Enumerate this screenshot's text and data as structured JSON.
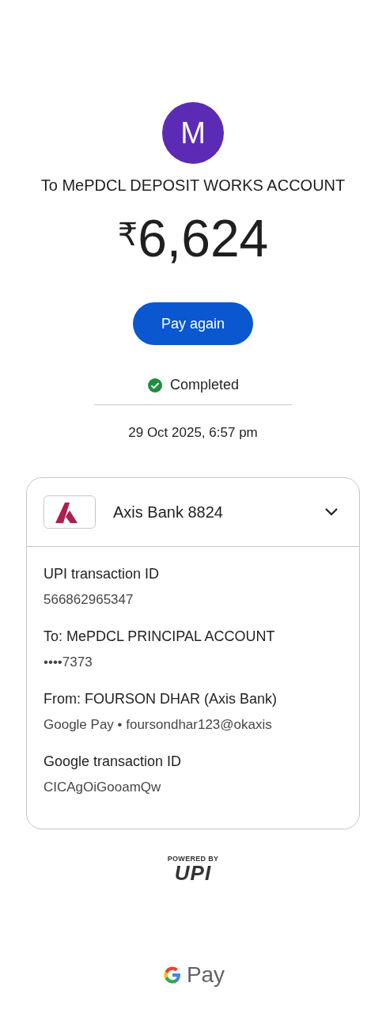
{
  "avatar": {
    "letter": "M"
  },
  "recipient": "To MePDCL DEPOSIT WORKS ACCOUNT",
  "amount": {
    "currency": "₹",
    "value": "6,624"
  },
  "pay_again_button": "Pay again",
  "status": "Completed",
  "date": "29 Oct 2025, 6:57 pm",
  "account_card": {
    "bank": "Axis Bank 8824",
    "details": [
      {
        "label": "UPI transaction ID",
        "value": "566862965347"
      },
      {
        "label": "To: MePDCL PRINCIPAL ACCOUNT",
        "value": "••••7373"
      },
      {
        "label": "From: FOURSON DHAR (Axis Bank)",
        "value": "Google Pay • foursondhar123@okaxis"
      },
      {
        "label": "Google transaction ID",
        "value": "CICAgOiGooamQw"
      }
    ]
  },
  "upi_badge": {
    "caption": "POWERED BY",
    "mark": "UPI"
  },
  "footer_brand": "Pay"
}
